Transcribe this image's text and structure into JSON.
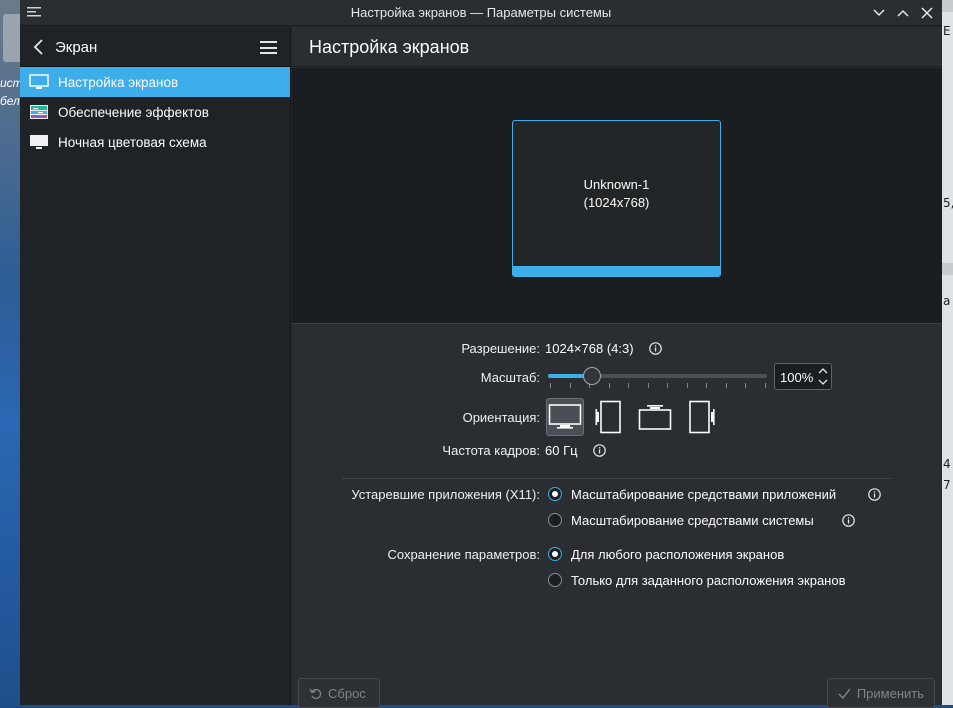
{
  "window": {
    "title": "Настройка экранов — Параметры системы"
  },
  "sidebar": {
    "header_label": "Экран",
    "items": [
      {
        "label": "Настройка экранов",
        "icon": "monitor-icon",
        "active": true
      },
      {
        "label": "Обеспечение эффектов",
        "icon": "compositor-icon",
        "active": false
      },
      {
        "label": "Ночная цветовая схема",
        "icon": "monitor-icon",
        "active": false
      }
    ]
  },
  "page": {
    "title": "Настройка экранов"
  },
  "display_preview": {
    "name": "Unknown-1",
    "resolution": "(1024x768)"
  },
  "settings": {
    "resolution_label": "Разрешение:",
    "resolution_value": "1024×768 (4:3)",
    "scale_label": "Масштаб:",
    "scale_value": "100%",
    "scale_fraction": 0.2,
    "orientation_label": "Ориентация:",
    "refresh_label": "Частота кадров:",
    "refresh_value": "60 Гц"
  },
  "legacy": {
    "label": "Устаревшие приложения (X11):",
    "options": [
      {
        "label": "Масштабирование средствами приложений",
        "checked": true
      },
      {
        "label": "Масштабирование средствами системы",
        "checked": false
      }
    ]
  },
  "save": {
    "label": "Сохранение параметров:",
    "options": [
      {
        "label": "Для любого расположения экранов",
        "checked": true
      },
      {
        "label": "Только для заданного расположения экранов",
        "checked": false
      }
    ]
  },
  "buttons": {
    "reset": "Сброс",
    "apply": "Применить"
  },
  "desktop_fragments": {
    "left_1": "ист",
    "left_2": "бел",
    "right_1": "5,",
    "right_2": "а",
    "right_3": "4",
    "right_4": "7"
  },
  "colors": {
    "accent": "#3daee9",
    "window_bg": "#2a2e32",
    "sidebar_bg": "#1f2226"
  }
}
